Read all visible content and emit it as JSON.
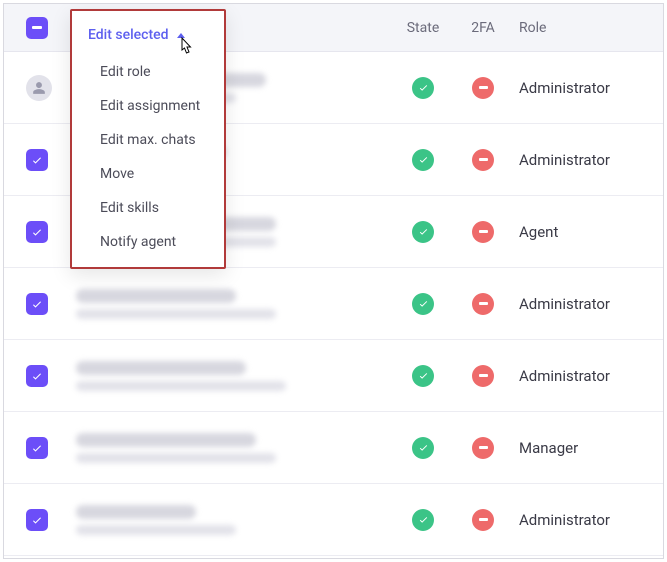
{
  "header": {
    "edit_selected_label": "Edit selected",
    "state_label": "State",
    "twofa_label": "2FA",
    "role_label": "Role"
  },
  "dropdown": {
    "title": "Edit selected",
    "items": [
      "Edit role",
      "Edit assignment",
      "Edit max. chats",
      "Move",
      "Edit skills",
      "Notify agent"
    ]
  },
  "rows": [
    {
      "checked": false,
      "avatar": true,
      "state": "ok",
      "twofa": "off",
      "role": "Administrator"
    },
    {
      "checked": true,
      "avatar": false,
      "state": "ok",
      "twofa": "off",
      "role": "Administrator"
    },
    {
      "checked": true,
      "avatar": false,
      "state": "ok",
      "twofa": "off",
      "role": "Agent"
    },
    {
      "checked": true,
      "avatar": false,
      "state": "ok",
      "twofa": "off",
      "role": "Administrator"
    },
    {
      "checked": true,
      "avatar": false,
      "state": "ok",
      "twofa": "off",
      "role": "Administrator"
    },
    {
      "checked": true,
      "avatar": false,
      "state": "ok",
      "twofa": "off",
      "role": "Manager"
    },
    {
      "checked": true,
      "avatar": false,
      "state": "ok",
      "twofa": "off",
      "role": "Administrator"
    }
  ]
}
